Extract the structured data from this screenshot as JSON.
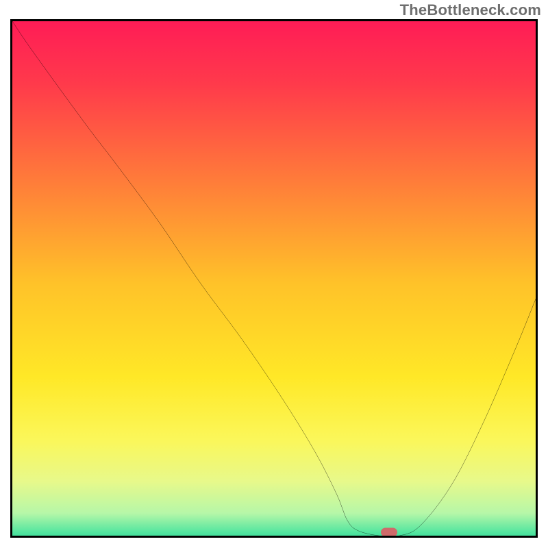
{
  "watermark": "TheBottleneck.com",
  "chart_data": {
    "type": "line",
    "title": "",
    "xlabel": "",
    "ylabel": "",
    "xlim": [
      0,
      100
    ],
    "ylim": [
      0,
      100
    ],
    "series": [
      {
        "name": "bottleneck-curve",
        "x": [
          0,
          4,
          14,
          20,
          28,
          36,
          44,
          52,
          58,
          62,
          64,
          66,
          70,
          74,
          78,
          84,
          90,
          96,
          100
        ],
        "values": [
          100,
          94,
          80,
          72,
          61,
          49,
          38,
          26,
          16,
          8,
          3,
          1,
          0,
          0,
          2,
          10,
          22,
          36,
          46
        ]
      }
    ],
    "marker": {
      "x": 72,
      "y": 0.6,
      "label": "optimal-point"
    },
    "background_gradient": {
      "stops": [
        {
          "pos": 0.0,
          "color": "#ff1c56"
        },
        {
          "pos": 0.12,
          "color": "#ff3a4b"
        },
        {
          "pos": 0.3,
          "color": "#ff7a3a"
        },
        {
          "pos": 0.5,
          "color": "#ffc229"
        },
        {
          "pos": 0.68,
          "color": "#ffe827"
        },
        {
          "pos": 0.8,
          "color": "#fbf75a"
        },
        {
          "pos": 0.88,
          "color": "#e7f98b"
        },
        {
          "pos": 0.94,
          "color": "#b6f7a8"
        },
        {
          "pos": 0.975,
          "color": "#57e6a0"
        },
        {
          "pos": 1.0,
          "color": "#1dd696"
        }
      ]
    }
  }
}
